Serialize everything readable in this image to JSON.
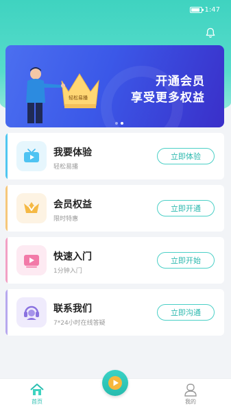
{
  "status_bar": {
    "time": "1:47"
  },
  "banner": {
    "title": "开通会员",
    "subtitle": "享受更多权益",
    "crown_text": "轻松易播"
  },
  "cards": [
    {
      "title": "我要体验",
      "desc": "轻松易播",
      "button": "立即体验",
      "stripe_color": "#4fc6f0",
      "icon": "tv-icon"
    },
    {
      "title": "会员权益",
      "desc": "限时特惠",
      "button": "立即开通",
      "stripe_color": "#f6c77a",
      "icon": "vip-crown-icon"
    },
    {
      "title": "快速入门",
      "desc": "1分钟入门",
      "button": "立即开始",
      "stripe_color": "#f2a0c4",
      "icon": "video-play-icon"
    },
    {
      "title": "联系我们",
      "desc": "7*24小时在线答疑",
      "button": "立即沟通",
      "stripe_color": "#b7a8ee",
      "icon": "headset-icon"
    }
  ],
  "tabbar": {
    "home": "首页",
    "mine": "我的"
  },
  "colors": {
    "accent": "#3fd3c0",
    "banner": "#3b58e8",
    "button_border": "#49cfc6"
  }
}
